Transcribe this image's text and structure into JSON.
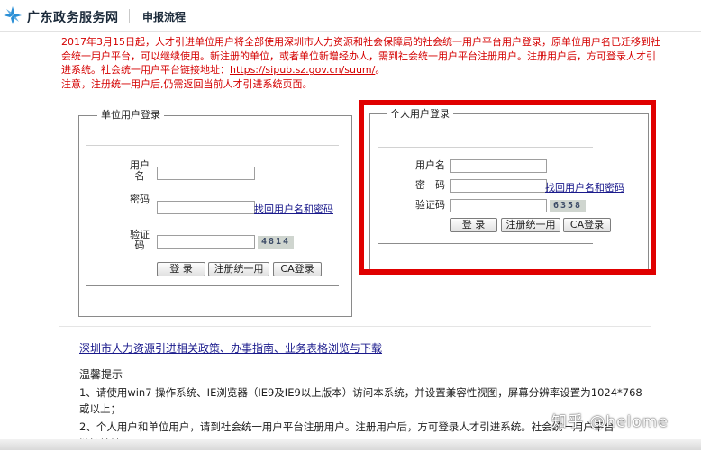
{
  "header": {
    "site_title": "广东政务服务网",
    "nav_link": "申报流程"
  },
  "notice": {
    "text": "2017年3月15日起，人才引进单位用户将全部使用深圳市人力资源和社会保障局的社会统一用户平台用户登录，原单位用户名已迁移到社会统一用户平台，可以继续使用。新注册的单位，或者单位新增经办人，需到社会统一用户平台注册用户。注册用户后，方可登录人才引进系统。社会统一用户平台链接地址：",
    "link": "https://sipub.sz.gov.cn/suum/",
    "link_suffix": "。",
    "line2": "注意，注册统一用户后,仍需返回当前人才引进系统页面。"
  },
  "unit_login": {
    "title": "单位用户登录",
    "username_label": "用户名",
    "password_label": "密码",
    "captcha_label": "验证码",
    "forgot_link": "找回用户名和密码",
    "captcha_code": "4814",
    "login_button": "登 录",
    "register_button": "注册统一用",
    "ca_button": "CA登录"
  },
  "personal_login": {
    "title": "个人用户登录",
    "username_label": "用户名",
    "password_label": "密　码",
    "captcha_label": "验证码",
    "forgot_link": "找回用户名和密码",
    "captcha_code": "6358",
    "login_button": "登 录",
    "register_button": "注册统一用",
    "ca_button": "CA登录"
  },
  "policy_link": "深圳市人力资源引进相关政策、办事指南、业务表格浏览与下载",
  "tips": {
    "title": "温馨提示",
    "line1": "1、请使用win7 操作系统、IE浏览器（IE9及IE9以上版本）访问本系统，并设置兼容性视图，屏幕分辨率设置为1024*768",
    "line1b": "或以上；",
    "line2": "2、个人用户和单位用户，请到社会统一用户平台注册用户。注册用户后，方可登录人才引进系统。社会统一用户平台",
    "line3": "链接地址：https://sipub.sz.gov.cn/suum/ ；"
  },
  "watermark": "知乎 @helome",
  "colors": {
    "notice_red": "#d40000",
    "highlight_frame": "#e00000",
    "logo_blue": "#2a8fd6",
    "link_blue": "#1a1a8c"
  }
}
